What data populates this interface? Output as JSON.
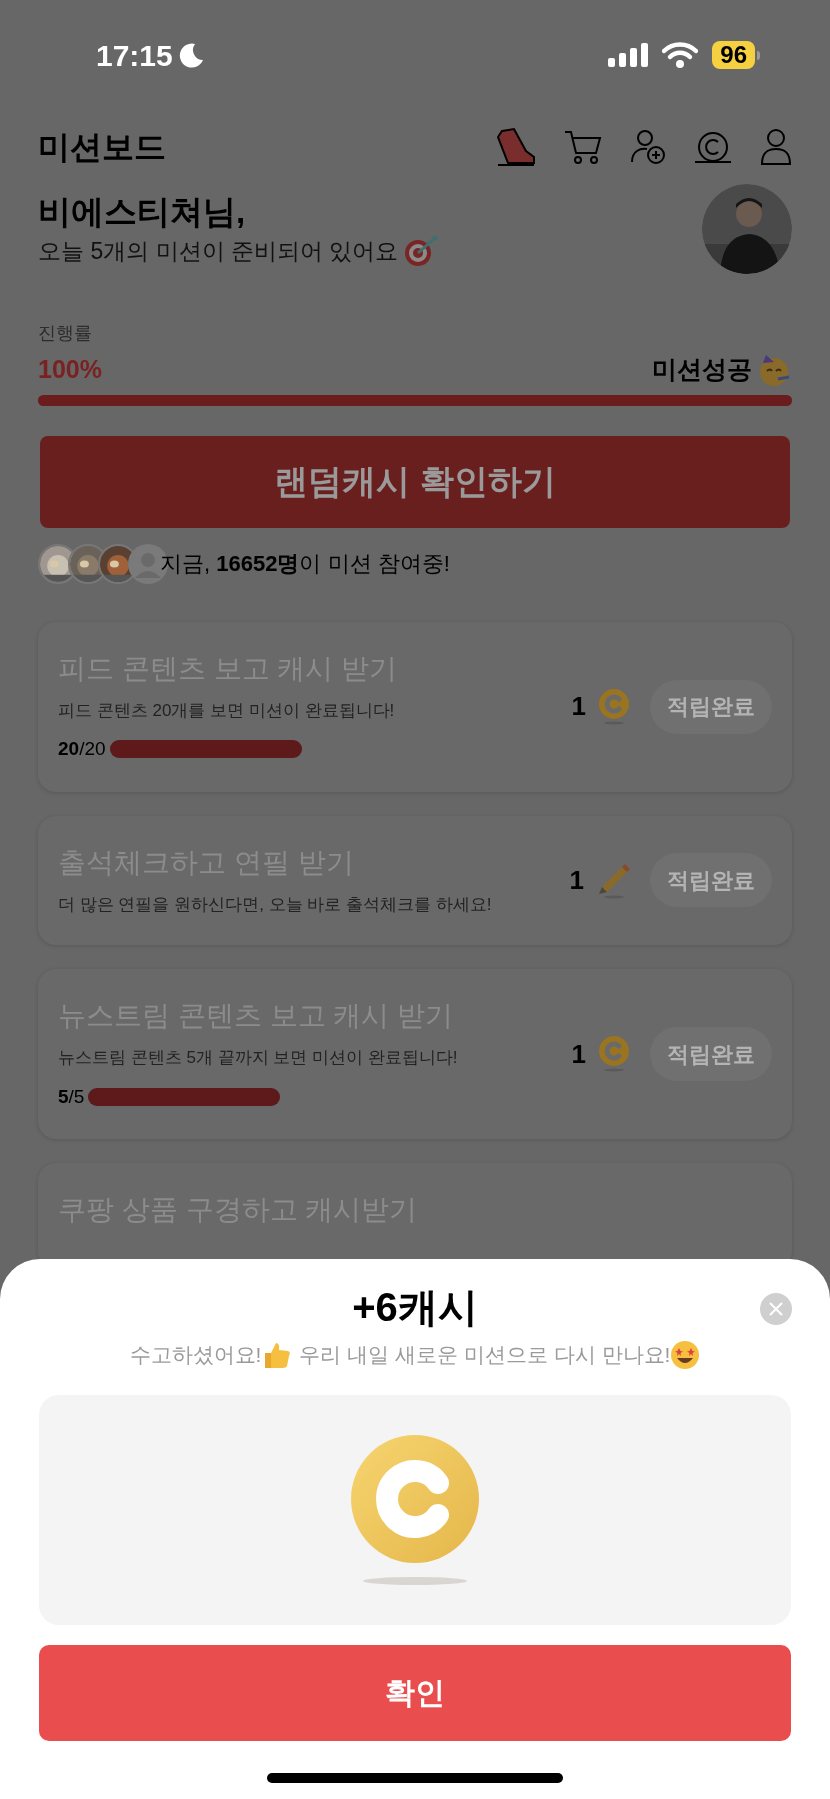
{
  "status_bar": {
    "time": "17:15",
    "battery": "96"
  },
  "header": {
    "title": "미션보드"
  },
  "greeting": {
    "name": "비에스티쳐님,",
    "subtitle": "오늘 5개의 미션이 준비되어 있어요"
  },
  "progress": {
    "label": "진행률",
    "percent": "100%",
    "level": 1,
    "result": "미션성공"
  },
  "random_cash_button": "랜덤캐시 확인하기",
  "participants": {
    "text": "지금, **16652명**이 미션 참여중!"
  },
  "missions": [
    {
      "title": "피드 콘텐츠 보고 캐시 받기",
      "description": "피드 콘텐츠 20개를 보면 미션이 완료됩니다!",
      "progress_text": "**20**/20",
      "level": 1,
      "reward": {
        "amount": "1",
        "kind": "coin"
      },
      "button": "적립완료"
    },
    {
      "title": "출석체크하고 연필 받기",
      "description": "더 많은 연필을 원하신다면, 오늘 바로 출석체크를 하세요!",
      "reward": {
        "amount": "1",
        "kind": "pencil"
      },
      "button": "적립완료"
    },
    {
      "title": "뉴스트림 콘텐츠 보고 캐시 받기",
      "description": "뉴스트림 콘텐츠 5개 끝까지 보면 미션이 완료됩니다!",
      "progress_text": "**5**/5",
      "level": 1,
      "reward": {
        "amount": "1",
        "kind": "coin"
      },
      "button": "적립완료"
    },
    {
      "title": "쿠팡 상품 구경하고 캐시받기"
    }
  ],
  "sheet": {
    "title": "+6캐시",
    "message_1": "수고하셨어요!",
    "message_2": "우리 내일 새로운 미션으로 다시 만나요!",
    "confirm_button": "확인"
  }
}
